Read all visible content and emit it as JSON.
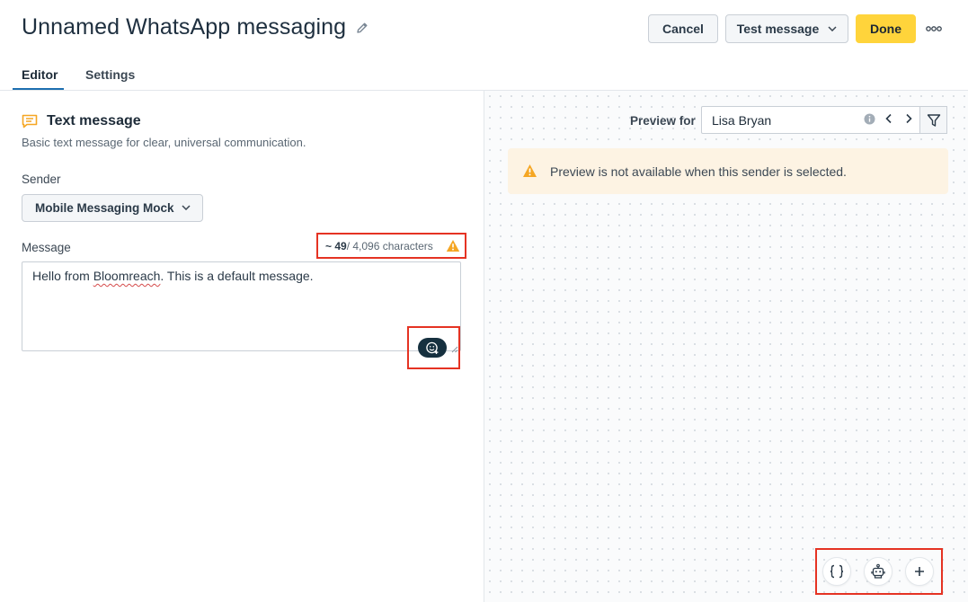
{
  "header": {
    "title": "Unnamed WhatsApp messaging",
    "cancel_label": "Cancel",
    "test_label": "Test message",
    "done_label": "Done"
  },
  "tabs": [
    {
      "label": "Editor",
      "active": true
    },
    {
      "label": "Settings",
      "active": false
    }
  ],
  "editor": {
    "type_title": "Text message",
    "type_desc": "Basic text message for clear, universal communication.",
    "sender_label": "Sender",
    "sender_value": "Mobile Messaging Mock",
    "message_label": "Message",
    "char_count_prefix": "~ 49",
    "char_count_suffix": "/ 4,096 characters",
    "message_pre": "Hello from ",
    "message_misspelled": "Bloomreach",
    "message_post": ". This is a default message."
  },
  "preview": {
    "label": "Preview for",
    "value": "Lisa Bryan",
    "alert": "Preview is not available when this sender is selected."
  },
  "colors": {
    "accent": "#ffd43b",
    "highlight": "#e53323",
    "warning": "#f5a623",
    "tab_underline": "#1d6fb0",
    "dark_button": "#16303f"
  },
  "icons": [
    "pencil-icon",
    "chevron-down-icon",
    "more-icon",
    "text-message-icon",
    "warning-icon",
    "emoji-add-icon",
    "info-icon",
    "chevron-left-icon",
    "chevron-right-icon",
    "filter-icon",
    "braces-icon",
    "robot-icon",
    "plus-icon"
  ]
}
